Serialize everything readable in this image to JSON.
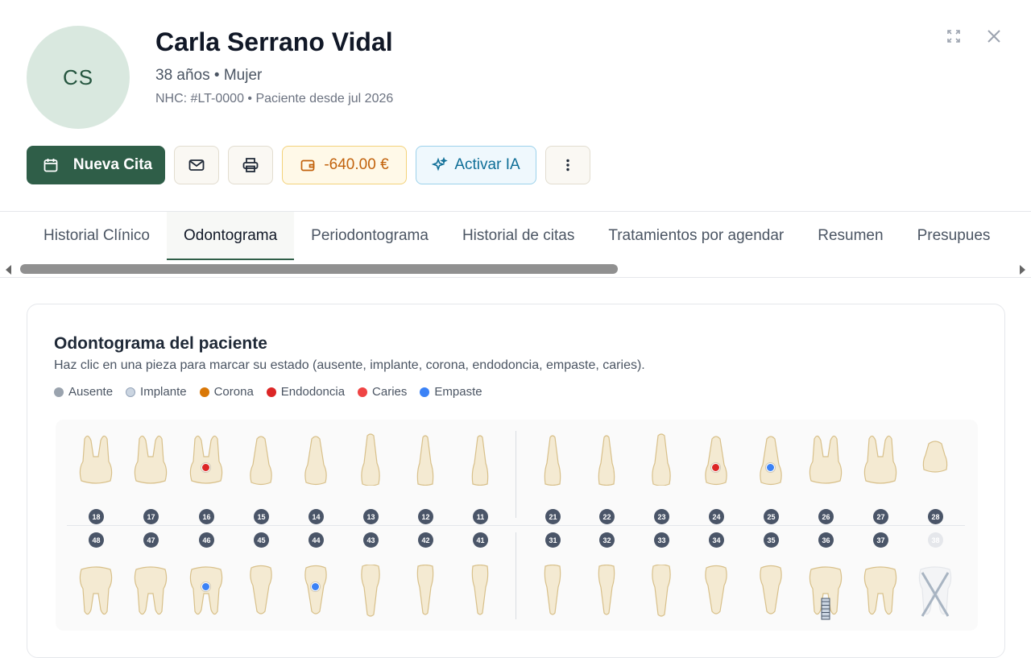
{
  "patient": {
    "initials": "CS",
    "name": "Carla Serrano Vidal",
    "age_sex": "38 años • Mujer",
    "record": "NHC: #LT-0000 • Paciente desde jul 2026"
  },
  "actions": {
    "new_appointment": "Nueva Cita",
    "balance": "-640.00 €",
    "ai": "Activar IA"
  },
  "tabs": [
    {
      "label": "Historial Clínico",
      "active": false
    },
    {
      "label": "Odontograma",
      "active": true
    },
    {
      "label": "Periodontograma",
      "active": false
    },
    {
      "label": "Historial de citas",
      "active": false
    },
    {
      "label": "Tratamientos por agendar",
      "active": false
    },
    {
      "label": "Resumen",
      "active": false
    },
    {
      "label": "Presupues",
      "active": false
    }
  ],
  "odontogram": {
    "title": "Odontograma del paciente",
    "subtitle": "Haz clic en una pieza para marcar su estado (ausente, implante, corona, endodoncia, empaste, caries).",
    "legend": [
      {
        "label": "Ausente",
        "color": "#9aa3ae"
      },
      {
        "label": "Implante",
        "color": "#cbd5e1"
      },
      {
        "label": "Corona",
        "color": "#d97706"
      },
      {
        "label": "Endodoncia",
        "color": "#dc2626"
      },
      {
        "label": "Caries",
        "color": "#ef4444"
      },
      {
        "label": "Empaste",
        "color": "#3b82f6"
      }
    ],
    "upper": [
      {
        "n": "18",
        "type": "molar",
        "state": ""
      },
      {
        "n": "17",
        "type": "molar",
        "state": ""
      },
      {
        "n": "16",
        "type": "molar",
        "state": "Endodoncia"
      },
      {
        "n": "15",
        "type": "premolar",
        "state": ""
      },
      {
        "n": "14",
        "type": "premolar",
        "state": ""
      },
      {
        "n": "13",
        "type": "canine",
        "state": ""
      },
      {
        "n": "12",
        "type": "incisor",
        "state": ""
      },
      {
        "n": "11",
        "type": "incisor",
        "state": ""
      },
      {
        "n": "21",
        "type": "incisor",
        "state": ""
      },
      {
        "n": "22",
        "type": "incisor",
        "state": ""
      },
      {
        "n": "23",
        "type": "canine",
        "state": ""
      },
      {
        "n": "24",
        "type": "premolar",
        "state": "Endodoncia"
      },
      {
        "n": "25",
        "type": "premolar",
        "state": "Empaste"
      },
      {
        "n": "26",
        "type": "molar",
        "state": ""
      },
      {
        "n": "27",
        "type": "molar",
        "state": ""
      },
      {
        "n": "28",
        "type": "molar-small",
        "state": ""
      }
    ],
    "lower": [
      {
        "n": "48",
        "type": "molar",
        "state": ""
      },
      {
        "n": "47",
        "type": "molar",
        "state": ""
      },
      {
        "n": "46",
        "type": "molar",
        "state": "Empaste"
      },
      {
        "n": "45",
        "type": "premolar",
        "state": ""
      },
      {
        "n": "44",
        "type": "premolar",
        "state": "Empaste"
      },
      {
        "n": "43",
        "type": "canine",
        "state": ""
      },
      {
        "n": "42",
        "type": "incisor",
        "state": ""
      },
      {
        "n": "41",
        "type": "incisor",
        "state": ""
      },
      {
        "n": "31",
        "type": "incisor",
        "state": ""
      },
      {
        "n": "32",
        "type": "incisor",
        "state": ""
      },
      {
        "n": "33",
        "type": "canine",
        "state": ""
      },
      {
        "n": "34",
        "type": "premolar",
        "state": ""
      },
      {
        "n": "35",
        "type": "premolar",
        "state": ""
      },
      {
        "n": "36",
        "type": "molar",
        "state": "Implante"
      },
      {
        "n": "37",
        "type": "molar",
        "state": ""
      },
      {
        "n": "38",
        "type": "molar",
        "state": "Ausente"
      }
    ]
  }
}
